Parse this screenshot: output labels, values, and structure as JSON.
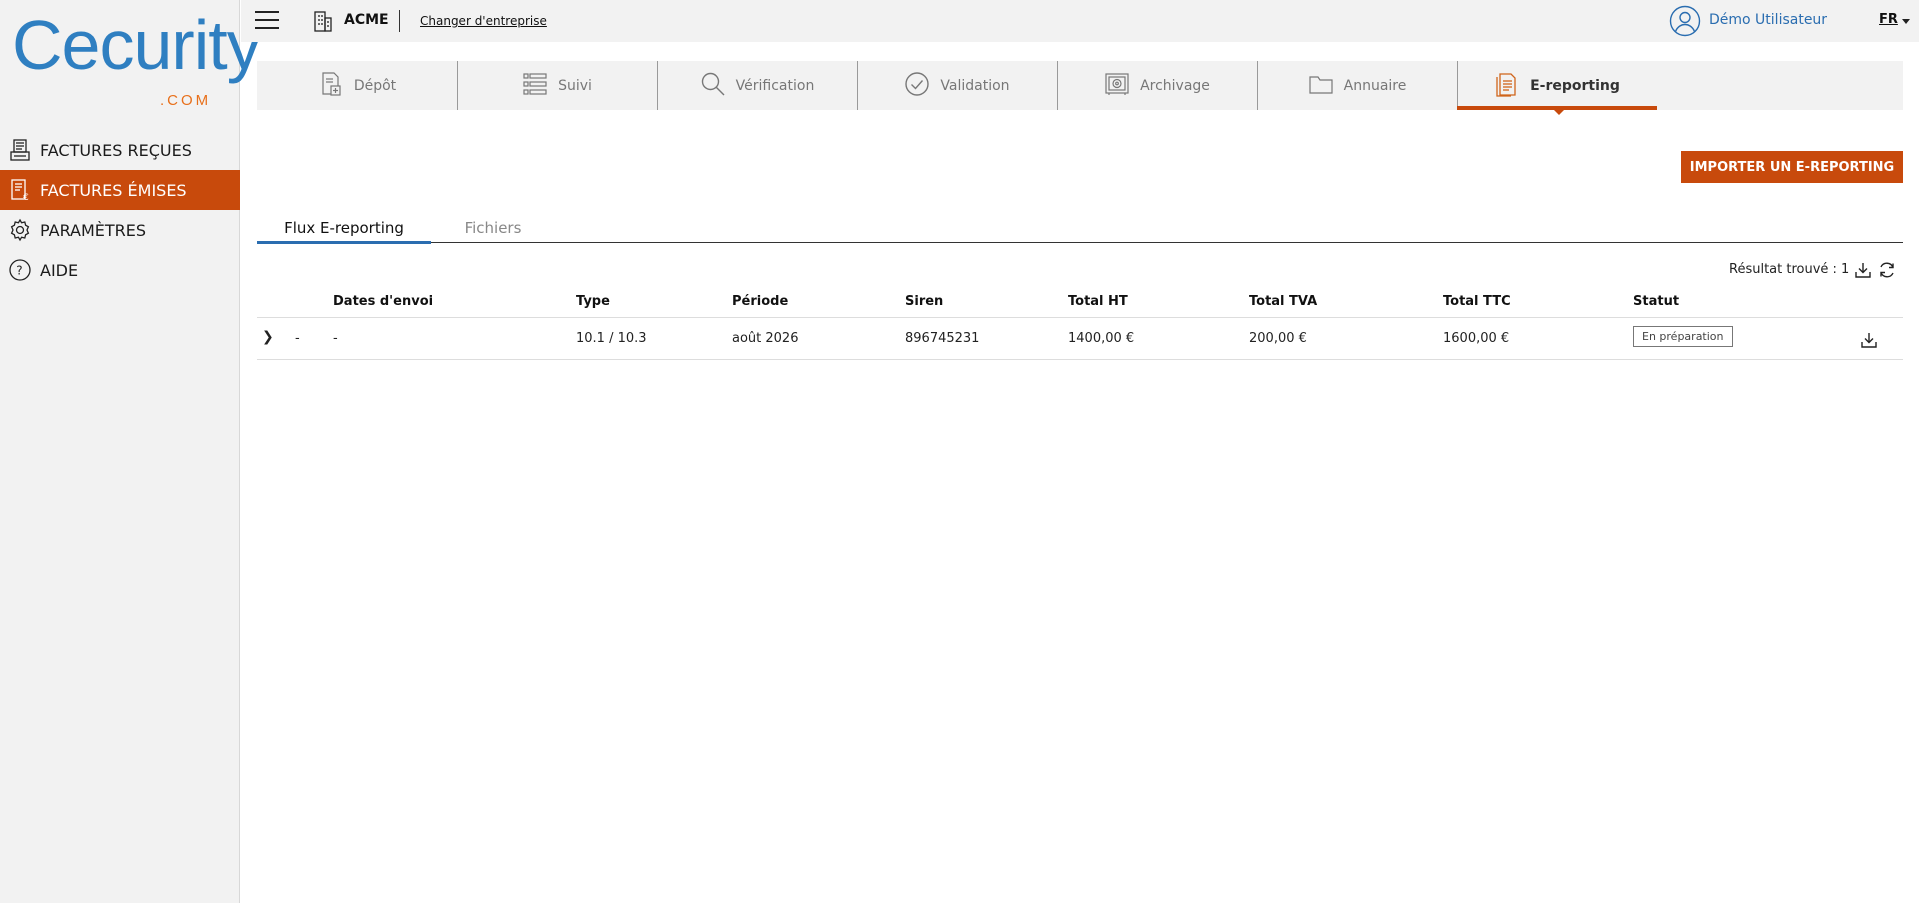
{
  "brand": {
    "logo_text": "Cecurity",
    "logo_suffix": ".COM",
    "primary": "#2f7fc1",
    "accent": "#c84a0c"
  },
  "sidebar": {
    "items": [
      {
        "label": "FACTURES REÇUES",
        "icon": "printer-invoice-icon",
        "active": false
      },
      {
        "label": "FACTURES ÉMISES",
        "icon": "invoice-euro-icon",
        "active": true
      },
      {
        "label": "PARAMÈTRES",
        "icon": "gear-icon",
        "active": false
      },
      {
        "label": "AIDE",
        "icon": "help-circle-icon",
        "active": false
      }
    ]
  },
  "topbar": {
    "company": "ACME",
    "change_company": "Changer d'entreprise",
    "user": "Démo Utilisateur",
    "lang": "FR"
  },
  "main_tabs": [
    {
      "label": "Dépôt",
      "icon": "upload-document-icon"
    },
    {
      "label": "Suivi",
      "icon": "list-icon"
    },
    {
      "label": "Vérification",
      "icon": "search-icon"
    },
    {
      "label": "Validation",
      "icon": "check-circle-icon"
    },
    {
      "label": "Archivage",
      "icon": "safe-icon"
    },
    {
      "label": "Annuaire",
      "icon": "folder-icon"
    },
    {
      "label": "E-reporting",
      "icon": "document-icon",
      "active": true
    }
  ],
  "actions": {
    "import_label": "IMPORTER UN E-REPORTING"
  },
  "sub_tabs": [
    {
      "label": "Flux E-reporting",
      "active": true
    },
    {
      "label": "Fichiers",
      "active": false
    }
  ],
  "results": {
    "label": "Résultat trouvé : 1"
  },
  "table": {
    "columns": [
      "Dates d'envoi",
      "Type",
      "Période",
      "Siren",
      "Total HT",
      "Total TVA",
      "Total TTC",
      "Statut"
    ],
    "rows": [
      {
        "expander": "❯",
        "col0": "-",
        "date": "-",
        "type": "10.1 / 10.3",
        "periode": "août 2026",
        "siren": "896745231",
        "total_ht": "1400,00 €",
        "total_tva": "200,00 €",
        "total_ttc": "1600,00 €",
        "statut": "En préparation"
      }
    ]
  }
}
